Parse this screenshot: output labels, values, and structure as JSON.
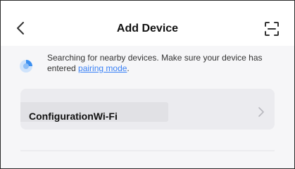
{
  "header": {
    "title": "Add Device",
    "back_icon": "chevron-left-icon",
    "scan_icon": "scan-icon"
  },
  "notice": {
    "icon": "searching-radar-icon",
    "text_before_link": "Searching for nearby devices. Make sure your device has entered ",
    "link_text": "pairing mode",
    "text_after_link": ".",
    "link_color": "#3b82f6"
  },
  "network_item": {
    "label": "ConfigurationWi-Fi",
    "chevron_icon": "chevron-right-icon"
  }
}
